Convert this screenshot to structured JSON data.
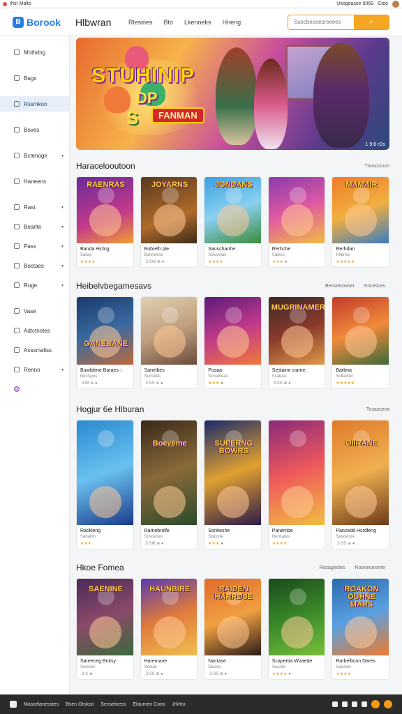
{
  "browser": {
    "title": "Ihsr  Malto",
    "url": "Uesgeasee 9069",
    "btn": "Cteo"
  },
  "header": {
    "logo": "Borook",
    "title": "Hlbwran",
    "nav": [
      "Rlesines",
      "Bto",
      "Lkenneks",
      "Hneng"
    ],
    "search_placeholder": "Suscbeceesrseees",
    "colors": {
      "accent": "#f5a623",
      "brand": "#2a7de1"
    }
  },
  "sidebar": {
    "items": [
      {
        "label": "Mothdng",
        "icon": "home-icon",
        "chev": false
      },
      {
        "label": "Bags",
        "icon": "bag-icon",
        "chev": false
      },
      {
        "label": "Rssmkon",
        "icon": "star-icon",
        "chev": false,
        "active": true
      },
      {
        "label": "Boves",
        "icon": "box-icon",
        "chev": false
      },
      {
        "label": "Bctenoge",
        "icon": "grid-icon",
        "chev": true
      },
      {
        "label": "Haneens",
        "icon": "list-icon",
        "chev": false
      },
      {
        "label": "Rast",
        "icon": "tag-icon",
        "chev": true
      },
      {
        "label": "Bearlte",
        "icon": "chart-icon",
        "chev": true
      },
      {
        "label": "Pass",
        "icon": "ticket-icon",
        "chev": true
      },
      {
        "label": "Boctaes",
        "icon": "folder-icon",
        "chev": true
      },
      {
        "label": "Ruge",
        "icon": "page-icon",
        "chev": true
      },
      {
        "label": "Vase",
        "icon": "vase-icon",
        "chev": false
      },
      {
        "label": "Adtctnotes",
        "icon": "note-icon",
        "chev": false
      },
      {
        "label": "Axssmaliss",
        "icon": "mail-icon",
        "chev": false
      },
      {
        "label": "Renno",
        "icon": "settings-icon",
        "chev": true
      }
    ]
  },
  "banner": {
    "line1": "STUHINIP",
    "line2": "DP",
    "line3": "FANMAN",
    "line4": "S",
    "badge": "1 9:8 rDs"
  },
  "sections": [
    {
      "title": "Haracelooutoon",
      "aux": "Tnoscoccm",
      "cards": [
        {
          "art": "RAENRAS",
          "title": "Banda Hiclng",
          "sub": "Sallas",
          "rating": "★★★★",
          "n": ""
        },
        {
          "art": "JOYARNS",
          "title": "Bubrelh ple",
          "sub": "Bonneese",
          "rating": "",
          "n": "3 SW ⊕ ●"
        },
        {
          "art": "JONDANS",
          "title": "Sauschanhe",
          "sub": "Solueclan",
          "rating": "★★★★",
          "n": ""
        },
        {
          "art": "",
          "title": "Rerhche",
          "sub": "Saless",
          "rating": "★★★",
          "n": "●"
        },
        {
          "art": "MAMAIR",
          "title": "Rerhdan",
          "sub": "Pebnes",
          "rating": "★★★★★",
          "n": ""
        }
      ]
    },
    {
      "title": "Heibelvbegamesavs",
      "aux": "Bessetstwoer",
      "aux2": "Fncesces",
      "cards": [
        {
          "art": "GANEBANE",
          "title": "Buwldene Baraes :",
          "sub": "Bectsyes",
          "rating": "",
          "n": "3 Bt ⊕ ●"
        },
        {
          "art": "",
          "title": "Sanelbes",
          "sub": "Sunsbes",
          "rating": "",
          "n": "3 SS ⊕ ●"
        },
        {
          "art": "",
          "title": "Pusaa",
          "sub": "Sunalneas",
          "rating": "★★★",
          "n": "●"
        },
        {
          "art": "MUGRINAMER",
          "title": "Seslaine ciame.",
          "sub": "Ssaless",
          "rating": "",
          "n": "3 SS ⊕ ●"
        },
        {
          "art": "",
          "title": "Barbna",
          "sub": "Soltaliner",
          "rating": "★★★★★",
          "n": ""
        }
      ]
    },
    {
      "title": "Hogjur 6e Hlburan",
      "aux": "Tosasseva",
      "cards": [
        {
          "art": "",
          "title": "Rackleng",
          "sub": "Sahaldn",
          "rating": "★★★",
          "n": ""
        },
        {
          "art": "Boeveme",
          "title": "Ramebrolfe",
          "sub": "Soscenas",
          "rating": "",
          "n": "5 SM ⊕ ●"
        },
        {
          "art": "SUPERNG BOWRS",
          "title": "Ssreleshe",
          "sub": "Solcone",
          "rating": "★★★",
          "n": "●"
        },
        {
          "art": "",
          "title": "Panembe",
          "sub": "Nuocates",
          "rating": "★★★★",
          "n": ""
        },
        {
          "art": "OIIRANE",
          "title": "Pancedd Hsrdleng",
          "sub": "Sascetsre",
          "rating": "",
          "n": "3 SS ⊕ ●"
        }
      ]
    },
    {
      "title": "Hkoe Fomea",
      "aux": "Rosagectes",
      "aux2": "Roonecesmre",
      "cards": [
        {
          "art": "SAENINE",
          "title": "Sareeceg Bnitsy",
          "sub": "Seleses",
          "rating": "",
          "n": "3 S ★"
        },
        {
          "art": "HAUNBIRE",
          "title": "Haremane",
          "sub": "Seduls",
          "rating": "",
          "n": "3 SS ⊕ ●"
        },
        {
          "art": "RAIDEN HARRDSE",
          "title": "Nactase",
          "sub": "Saules",
          "rating": "",
          "n": "3 SS ⊕ ●"
        },
        {
          "art": "",
          "title": "Scapertia Woaede",
          "sub": "Sosalin",
          "rating": "★★★★",
          "n": "●"
        },
        {
          "art": "ROAKON OUHNE MARS",
          "title": "Rarbelbcon Dares",
          "sub": "Sanales",
          "rating": "★★★★",
          "n": ""
        }
      ]
    }
  ],
  "footer": {
    "items": [
      "Masselanesstes",
      "Bsen Otstost",
      "Senselness",
      "Elaumen Coos",
      "Jrkhto"
    ]
  }
}
